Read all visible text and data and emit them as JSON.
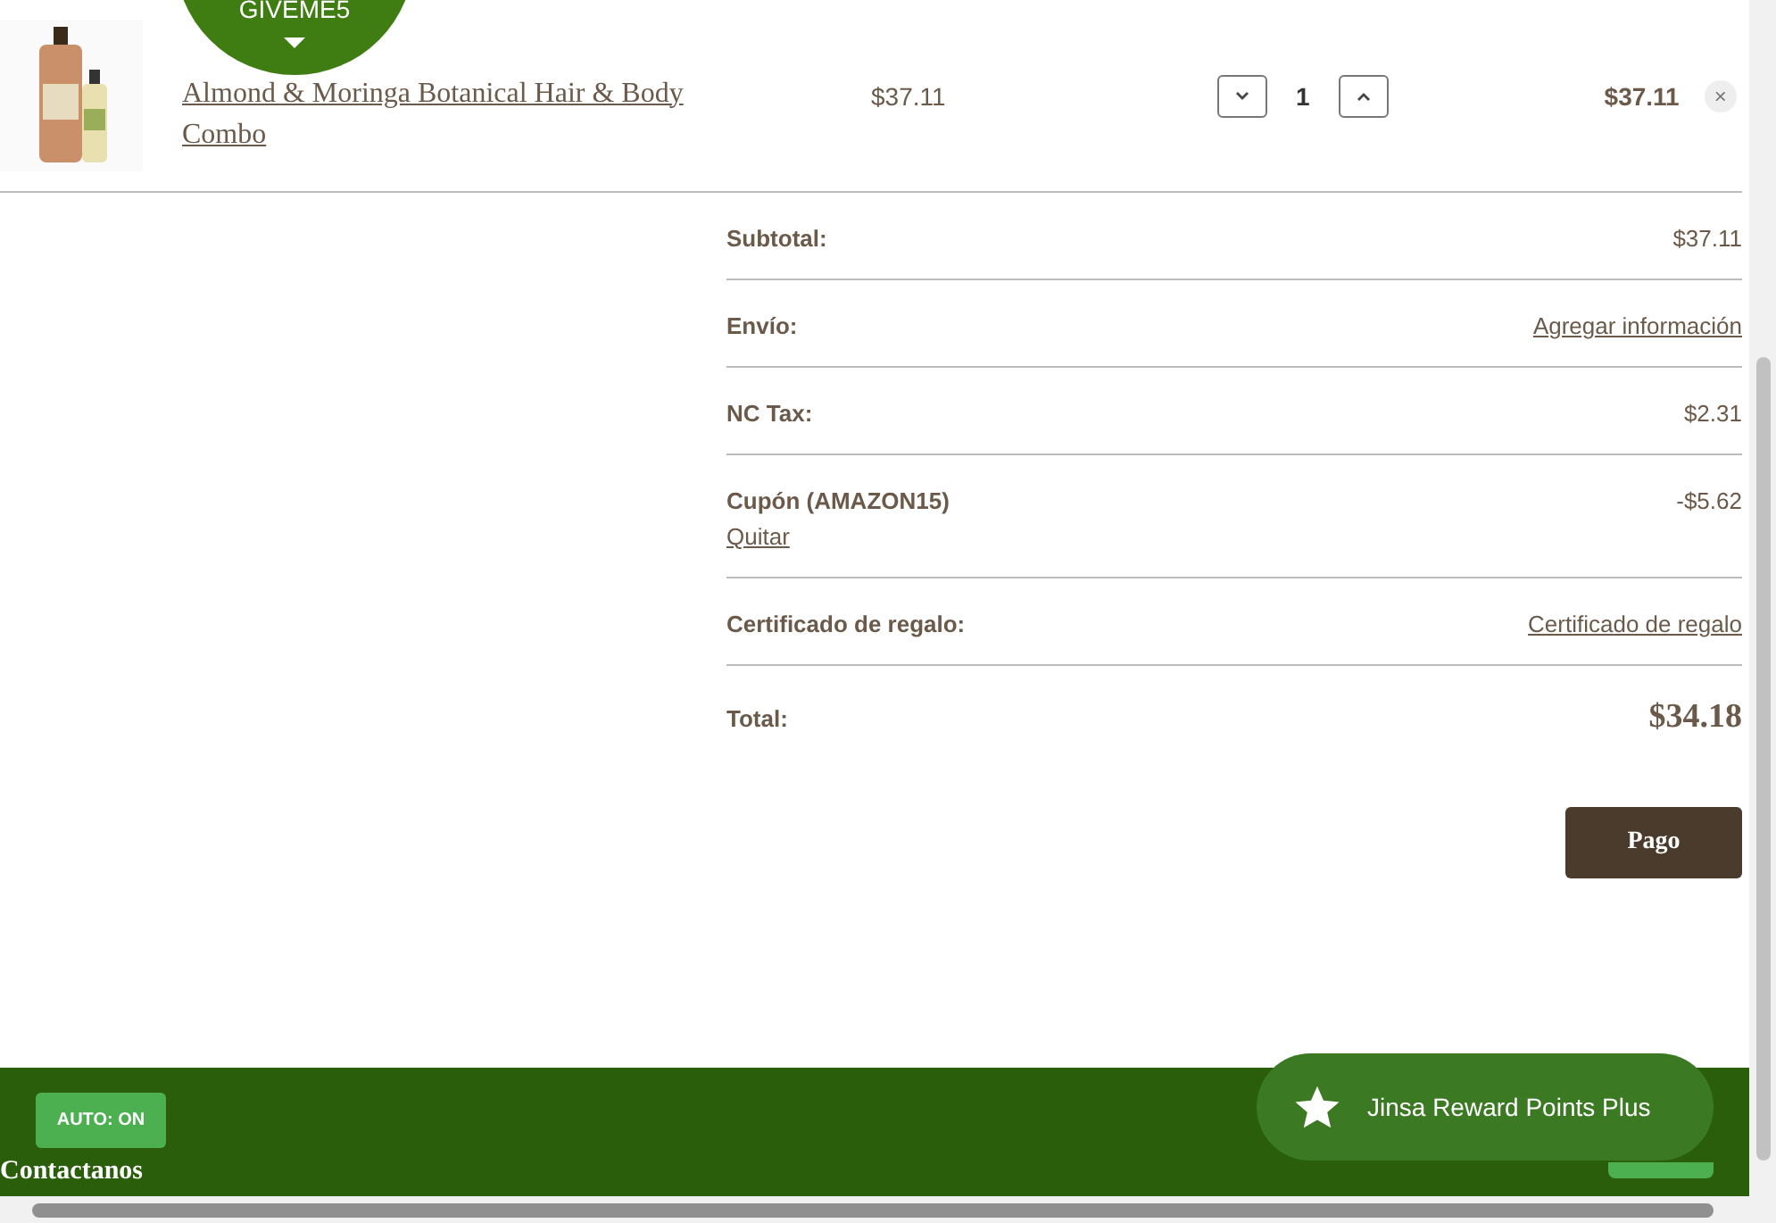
{
  "cart_item": {
    "title": "Almond & Moringa Botanical Hair & Body Combo",
    "unit_price": "$37.11",
    "quantity": "1",
    "line_total": "$37.11",
    "remove": "×"
  },
  "coupon_badge": {
    "code": "GIVEME5"
  },
  "summary": [
    {
      "kind": "value",
      "label": "Subtotal:",
      "value": "$37.11"
    },
    {
      "kind": "link",
      "label": "Envío:",
      "value": "Agregar información"
    },
    {
      "kind": "value",
      "label": "NC Tax:",
      "value": "$2.31"
    },
    {
      "kind": "coupon",
      "label": "Cupón (AMAZON15)",
      "value": "-$5.62",
      "action": "Quitar"
    },
    {
      "kind": "link",
      "label": "Certificado de regalo:",
      "value": "Certificado de regalo"
    },
    {
      "kind": "total",
      "label": "Total:",
      "value": "$34.18"
    }
  ],
  "checkout_button": "Pago",
  "footer": {
    "heading": "Contactanos",
    "auto_badge": "AUTO: ON",
    "rewards": "Jinsa Reward Points Plus"
  }
}
